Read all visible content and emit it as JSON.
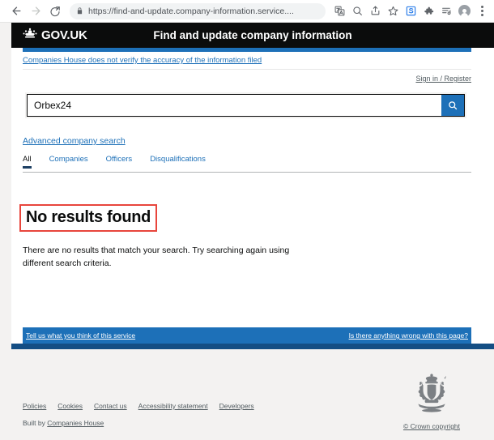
{
  "browser": {
    "back_icon": "back-arrow-icon",
    "forward_icon": "forward-arrow-icon",
    "reload_icon": "reload-icon",
    "lock_icon": "lock-icon",
    "url": "https://find-and-update.company-information.service....",
    "toolbar_icons": [
      "translate-icon",
      "zoom-search-icon",
      "share-icon",
      "bookmark-star-icon",
      "extension-s-icon",
      "puzzle-extensions-icon",
      "reading-list-icon",
      "profile-avatar-icon",
      "three-dot-menu-icon"
    ]
  },
  "header": {
    "brand": "GOV.UK",
    "crown_icon": "crown-icon",
    "service_title": "Find and update company information"
  },
  "disclaimer": {
    "text": "Companies House does not verify the accuracy of the information filed"
  },
  "account": {
    "signin_label": "Sign in / Register"
  },
  "search": {
    "value": "Orbex24",
    "placeholder": "",
    "button_icon": "search-icon",
    "advanced_label": "Advanced company search"
  },
  "tabs": [
    {
      "label": "All",
      "active": true
    },
    {
      "label": "Companies",
      "active": false
    },
    {
      "label": "Officers",
      "active": false
    },
    {
      "label": "Disqualifications",
      "active": false
    }
  ],
  "results": {
    "heading": "No results found",
    "body": "There are no results that match your search. Try searching again using different search criteria.",
    "annotation_color": "#e8453c"
  },
  "feedback": {
    "left_link": "Tell us what you think of this service",
    "right_link": "Is there anything wrong with this page?"
  },
  "footer": {
    "links": [
      "Policies",
      "Cookies",
      "Contact us",
      "Accessibility statement",
      "Developers"
    ],
    "built_by_prefix": "Built by",
    "built_by_link": "Companies House",
    "crest_icon": "royal-coat-of-arms-icon",
    "crown_copyright": "© Crown copyright"
  },
  "colors": {
    "govuk_black": "#0b0c0c",
    "govuk_blue": "#1d70b8",
    "grey_bg": "#f3f2f1",
    "link_grey": "#505a5f"
  }
}
